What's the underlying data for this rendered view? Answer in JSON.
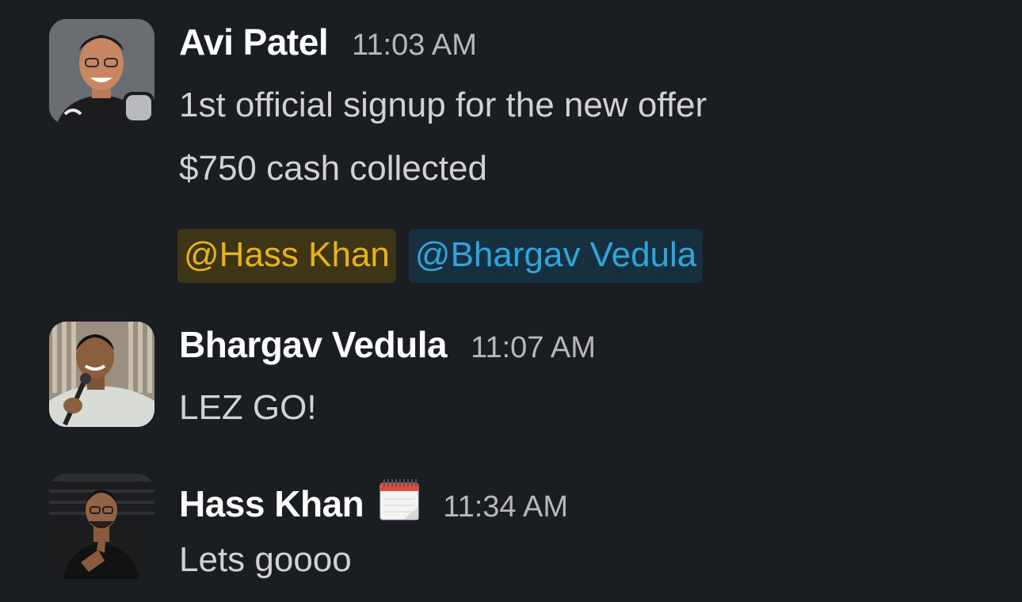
{
  "messages": [
    {
      "author": "Avi Patel",
      "time": "11:03 AM",
      "lines": [
        "1st official signup for the new offer",
        "$750 cash collected"
      ],
      "mentions": [
        "@Hass Khan",
        "@Bhargav Vedula"
      ]
    },
    {
      "author": "Bhargav Vedula",
      "time": "11:07 AM",
      "lines": [
        "LEZ GO!"
      ]
    },
    {
      "author": "Hass Khan",
      "status_emoji": "calendar-icon",
      "time": "11:34 AM",
      "lines": [
        "Lets goooo"
      ]
    }
  ],
  "colors": {
    "background": "#1a1d21",
    "mention_highlight_bg": "#3d3516",
    "mention_highlight_text": "#e8b21a",
    "mention_bg": "#17303f",
    "mention_text": "#2ea6dd"
  }
}
